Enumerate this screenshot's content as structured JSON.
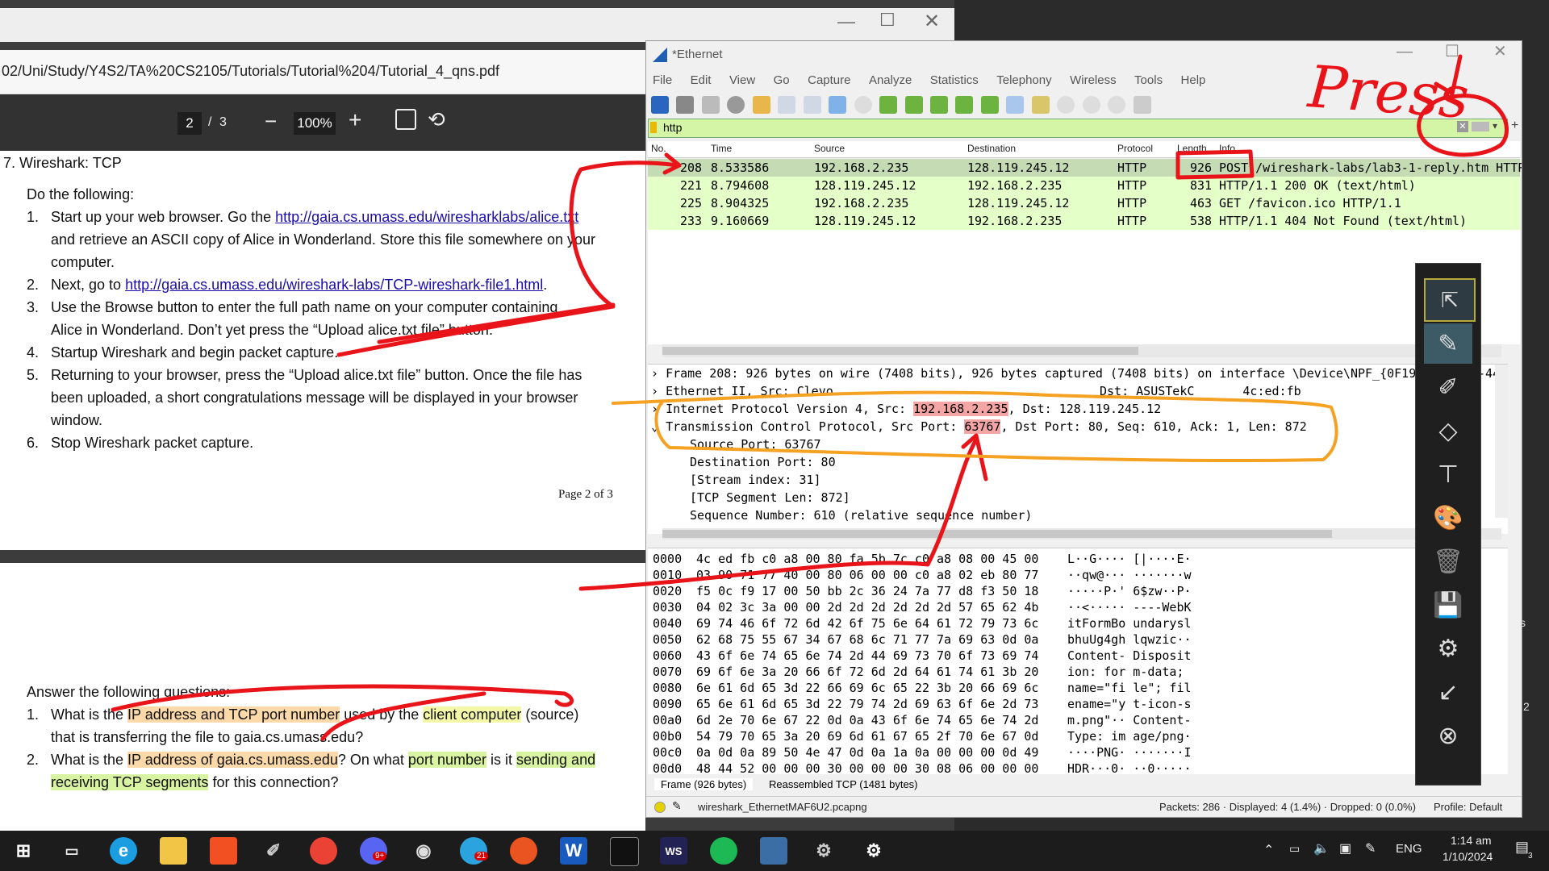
{
  "pdf": {
    "path": "02/Uni/Study/Y4S2/TA%20CS2105/Tutorials/Tutorial%204/Tutorial_4_qns.pdf",
    "page_current": "2",
    "page_sep": "/",
    "page_total": "3",
    "zoom": "100%",
    "section_heading": "7.   Wireshark: TCP",
    "intro": "Do the following:",
    "steps": [
      {
        "n": "1.",
        "pre": "Start up your web browser. Go the ",
        "link": "http://gaia.cs.umass.edu/wiresharklabs/alice.txt",
        "post": "and retrieve an ASCII copy of Alice in Wonderland. Store this file somewhere on your",
        "post2": "computer."
      },
      {
        "n": "2.",
        "pre": "Next, go to ",
        "link": "http://gaia.cs.umass.edu/wireshark-labs/TCP-wireshark-file1.html",
        "post": "."
      },
      {
        "n": "3.",
        "l1": "Use the Browse button to enter the full path name on your computer containing",
        "l2": "Alice in Wonderland. Don’t yet press the “Upload alice.txt file” button."
      },
      {
        "n": "4.",
        "l1": "Startup Wireshark and begin packet capture."
      },
      {
        "n": "5.",
        "l1": "Returning to your browser, press the “Upload alice.txt file” button. Once the file has",
        "l2": "been uploaded, a short congratulations message will be displayed in your browser",
        "l3": "window."
      },
      {
        "n": "6.",
        "l1": "Stop Wireshark packet capture."
      }
    ],
    "page_footer": "Page 2 of 3",
    "answer_intro": "Answer the following questions:",
    "q1_a": "What is the ",
    "q1_b": "IP address and TCP port number",
    "q1_c": " used by the ",
    "q1_d": "client computer",
    "q1_e": " (source)",
    "q1_f": "that is transferring the file to gaia.cs.umass.edu?",
    "q2_a": "What is the ",
    "q2_b": "IP address of gaia.cs.umass.edu",
    "q2_c": "? On what ",
    "q2_d": "port number",
    "q2_e": " is it ",
    "q2_f": "sending and",
    "q2_g": "receiving TCP segments",
    "q2_h": " for this connection?"
  },
  "wireshark": {
    "title": "*Ethernet",
    "menu": [
      "File",
      "Edit",
      "View",
      "Go",
      "Capture",
      "Analyze",
      "Statistics",
      "Telephony",
      "Wireless",
      "Tools",
      "Help"
    ],
    "filter": "http",
    "columns": [
      "No.",
      "Time",
      "Source",
      "Destination",
      "Protocol",
      "Length",
      "Info"
    ],
    "packets": [
      {
        "no": "208",
        "time": "8.533586",
        "src": "192.168.2.235",
        "dst": "128.119.245.12",
        "proto": "HTTP",
        "len": "926",
        "info": "POST /wireshark-labs/lab3-1-reply.htm HTTP"
      },
      {
        "no": "221",
        "time": "8.794608",
        "src": "128.119.245.12",
        "dst": "192.168.2.235",
        "proto": "HTTP",
        "len": "831",
        "info": "HTTP/1.1 200 OK  (text/html)"
      },
      {
        "no": "225",
        "time": "8.904325",
        "src": "192.168.2.235",
        "dst": "128.119.245.12",
        "proto": "HTTP",
        "len": "463",
        "info": "GET /favicon.ico HTTP/1.1"
      },
      {
        "no": "233",
        "time": "9.160669",
        "src": "128.119.245.12",
        "dst": "192.168.2.235",
        "proto": "HTTP",
        "len": "538",
        "info": "HTTP/1.1 404 Not Found  (text/html)"
      }
    ],
    "detail": {
      "frame": "Frame 208: 926 bytes on wire (7408 bits), 926 bytes captured (7408 bits) on interface \\Device\\NPF_{0F19",
      "frame_tail": "0-44",
      "eth": "Ethernet II, Src: Clevo",
      "eth_dst": "Dst: ASUSTekC",
      "eth_dst_mac": "4c:ed:fb",
      "ip_pre": "Internet Protocol Version 4, Src: ",
      "ip_src": "192.168.2.235",
      "ip_post": ", Dst: 128.119.245.12",
      "tcp_pre": "Transmission Control Protocol, Src Port: ",
      "tcp_port": "63767",
      "tcp_post": ", Dst Port: 80, Seq: 610, Ack: 1, Len: 872",
      "sub": [
        "Source Port: 63767",
        "Destination Port: 80",
        "[Stream index: 31]",
        "[TCP Segment Len: 872]",
        "Sequence Number: 610    (relative sequence number)"
      ]
    },
    "hex": [
      {
        "off": "0000",
        "bytes": "4c ed fb c0 a8 00 80 fa  5b 7c c0 a8 08 00 45 00",
        "ascii": "L··G····  [|····E·"
      },
      {
        "off": "0010",
        "bytes": "03 90 71 77 40 00 80 06  00 00 c0 a8 02 eb 80 77",
        "ascii": "··qw@···  ·······w"
      },
      {
        "off": "0020",
        "bytes": "f5 0c f9 17 00 50 bb 2c  36 24 7a 77 d8 f3 50 18",
        "ascii": "·····P·'  6$zw··P·"
      },
      {
        "off": "0030",
        "bytes": "04 02 3c 3a 00 00 2d 2d  2d 2d 2d 2d 57 65 62 4b",
        "ascii": "··<·····  ----WebK"
      },
      {
        "off": "0040",
        "bytes": "69 74 46 6f 72 6d 42 6f  75 6e 64 61 72 79 73 6c",
        "ascii": "itFormBo  undarysl"
      },
      {
        "off": "0050",
        "bytes": "62 68 75 55 67 34 67 68  6c 71 77 7a 69 63 0d 0a",
        "ascii": "bhuUg4gh  lqwzic··"
      },
      {
        "off": "0060",
        "bytes": "43 6f 6e 74 65 6e 74 2d  44 69 73 70 6f 73 69 74",
        "ascii": "Content-  Disposit"
      },
      {
        "off": "0070",
        "bytes": "69 6f 6e 3a 20 66 6f 72  6d 2d 64 61 74 61 3b 20",
        "ascii": "ion: for  m-data; "
      },
      {
        "off": "0080",
        "bytes": "6e 61 6d 65 3d 22 66 69  6c 65 22 3b 20 66 69 6c",
        "ascii": "name=\"fi  le\"; fil"
      },
      {
        "off": "0090",
        "bytes": "65 6e 61 6d 65 3d 22 79  74 2d 69 63 6f 6e 2d 73",
        "ascii": "ename=\"y  t-icon-s"
      },
      {
        "off": "00a0",
        "bytes": "6d 2e 70 6e 67 22 0d 0a  43 6f 6e 74 65 6e 74 2d",
        "ascii": "m.png\"··  Content-"
      },
      {
        "off": "00b0",
        "bytes": "54 79 70 65 3a 20 69 6d  61 67 65 2f 70 6e 67 0d",
        "ascii": "Type: im  age/png·"
      },
      {
        "off": "00c0",
        "bytes": "0a 0d 0a 89 50 4e 47 0d  0a 1a 0a 00 00 00 0d 49",
        "ascii": "····PNG·  ·······I"
      },
      {
        "off": "00d0",
        "bytes": "48 44 52 00 00 00 30 00  00 00 30 08 06 00 00 00",
        "ascii": "HDR···0·  ··0·····"
      }
    ],
    "tabs": [
      "Frame (926 bytes)",
      "Reassembled TCP (1481 bytes)"
    ],
    "status_file": "wireshark_EthernetMAF6U2.pcapng",
    "status_packets": "Packets: 286 · Displayed: 4 (1.4%) · Dropped: 0 (0.0%)",
    "status_profile": "Profile: Default"
  },
  "annotation": {
    "handwriting": "Press"
  },
  "taskbar": {
    "language": "ENG",
    "time": "1:14 am",
    "date": "1/10/2024",
    "notif_count": "3",
    "badge_discord": "9+",
    "badge_telegram": "21"
  },
  "right_edge": {
    "s": "s",
    "two": "2"
  },
  "colors": {
    "accent_green": "#e4ffc7",
    "ink_red": "#e8141a",
    "ink_orange": "#f5a122"
  }
}
